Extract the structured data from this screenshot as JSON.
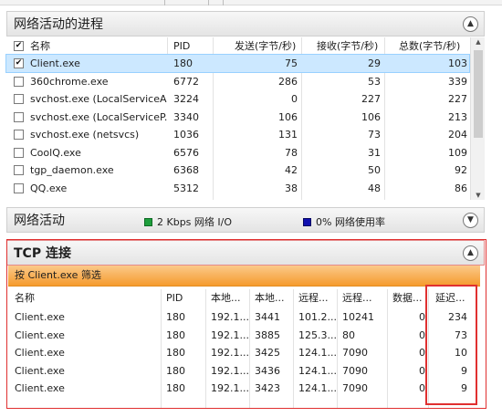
{
  "processes": {
    "title": "网络活动的进程",
    "columns": [
      "名称",
      "PID",
      "发送(字节/秒)",
      "接收(字节/秒)",
      "总数(字节/秒)"
    ],
    "rows": [
      {
        "name": "Client.exe",
        "pid": "180",
        "send": "75",
        "recv": "29",
        "total": "103",
        "checked": "✔"
      },
      {
        "name": "360chrome.exe",
        "pid": "6772",
        "send": "286",
        "recv": "53",
        "total": "339",
        "checked": ""
      },
      {
        "name": "svchost.exe (LocalServiceA...",
        "pid": "3224",
        "send": "0",
        "recv": "227",
        "total": "227",
        "checked": ""
      },
      {
        "name": "svchost.exe (LocalServiceP...",
        "pid": "3340",
        "send": "106",
        "recv": "106",
        "total": "213",
        "checked": ""
      },
      {
        "name": "svchost.exe (netsvcs)",
        "pid": "1036",
        "send": "131",
        "recv": "73",
        "total": "204",
        "checked": ""
      },
      {
        "name": "CoolQ.exe",
        "pid": "6576",
        "send": "78",
        "recv": "31",
        "total": "109",
        "checked": ""
      },
      {
        "name": "tgp_daemon.exe",
        "pid": "6368",
        "send": "42",
        "recv": "50",
        "total": "92",
        "checked": ""
      },
      {
        "name": "QQ.exe",
        "pid": "5312",
        "send": "38",
        "recv": "48",
        "total": "86",
        "checked": ""
      }
    ],
    "header_checked": "✔"
  },
  "activity": {
    "title": "网络活动",
    "io_label": "2 Kbps 网络 I/O",
    "usage_label": "0% 网络使用率",
    "io_color": "#1e9e3c",
    "usage_color": "#1010b0"
  },
  "tcp": {
    "title": "TCP 连接",
    "filter": "按 Client.exe 筛选",
    "columns": [
      "名称",
      "PID",
      "本地...",
      "本地...",
      "远程...",
      "远程...",
      "数据...",
      "延迟..."
    ],
    "rows": [
      {
        "name": "Client.exe",
        "pid": "180",
        "laddr": "192.1...",
        "lport": "3441",
        "raddr": "101.2...",
        "rport": "10241",
        "loss": "0",
        "latency": "234"
      },
      {
        "name": "Client.exe",
        "pid": "180",
        "laddr": "192.1...",
        "lport": "3885",
        "raddr": "125.3...",
        "rport": "80",
        "loss": "0",
        "latency": "73"
      },
      {
        "name": "Client.exe",
        "pid": "180",
        "laddr": "192.1...",
        "lport": "3425",
        "raddr": "124.1...",
        "rport": "7090",
        "loss": "0",
        "latency": "10"
      },
      {
        "name": "Client.exe",
        "pid": "180",
        "laddr": "192.1...",
        "lport": "3436",
        "raddr": "124.1...",
        "rport": "7090",
        "loss": "0",
        "latency": "9"
      },
      {
        "name": "Client.exe",
        "pid": "180",
        "laddr": "192.1...",
        "lport": "3423",
        "raddr": "124.1...",
        "rport": "7090",
        "loss": "0",
        "latency": "9"
      }
    ]
  },
  "colors": {
    "selection": "#cce8ff",
    "selection_border": "#99d1ff",
    "highlight_box": "#e03030",
    "filter_bar": "#f59b2e"
  },
  "icons": {
    "collapse": "chevron-up-icon",
    "expand": "chevron-down-icon"
  }
}
